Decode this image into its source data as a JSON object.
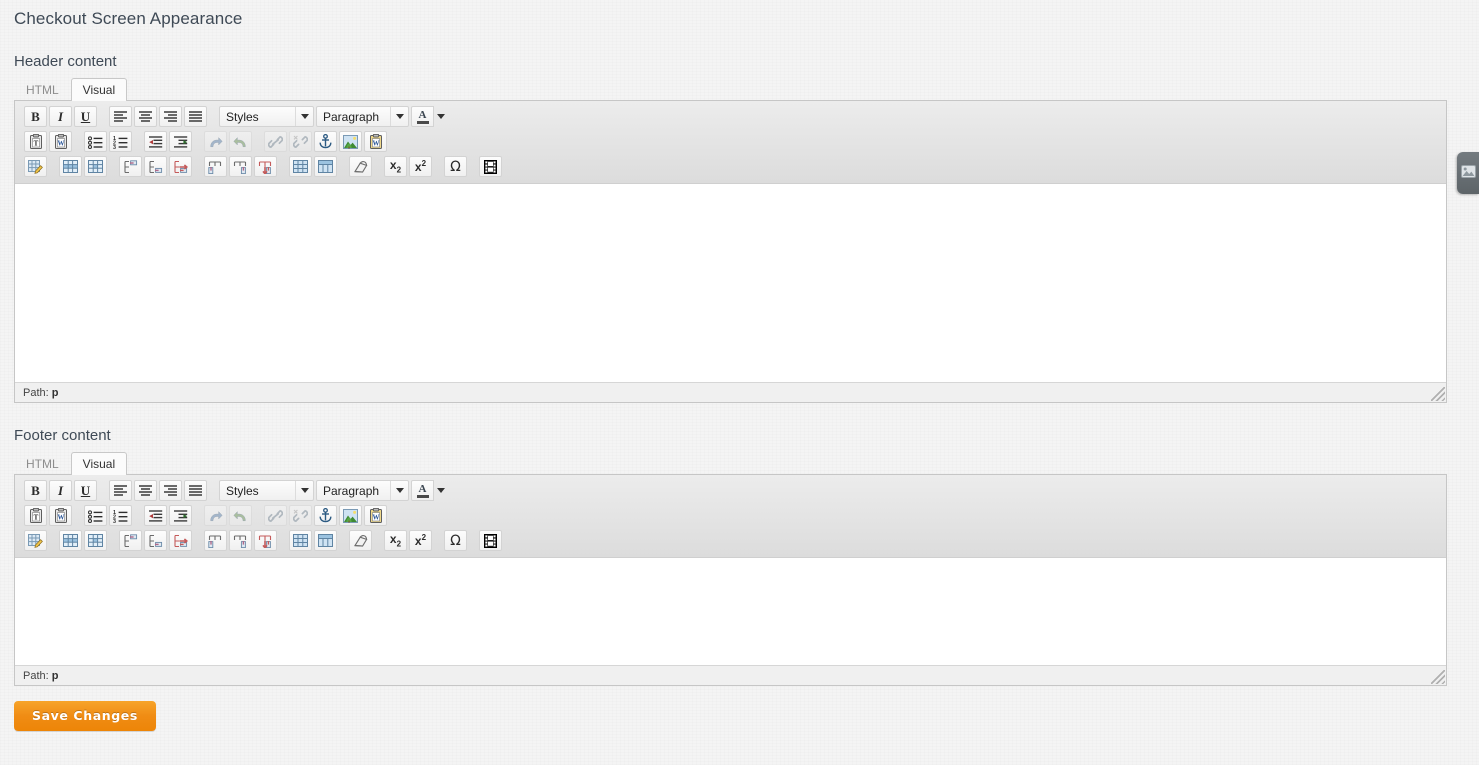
{
  "page": {
    "title": "Checkout Screen Appearance"
  },
  "colors": {
    "accent": "#f08c14",
    "page_bg": "#f4f4f4",
    "toolbar_bg": "#e4e4e4",
    "text": "#3f4a56"
  },
  "fields": [
    {
      "label": "Header content",
      "tabs": [
        {
          "label": "HTML",
          "active": false
        },
        {
          "label": "Visual",
          "active": true
        }
      ],
      "status": {
        "label": "Path:",
        "value": "p"
      },
      "body_height": 198,
      "content": ""
    },
    {
      "label": "Footer content",
      "tabs": [
        {
          "label": "HTML",
          "active": false
        },
        {
          "label": "Visual",
          "active": true
        }
      ],
      "status": {
        "label": "Path:",
        "value": "p"
      },
      "body_height": 107,
      "content": ""
    }
  ],
  "toolbar": {
    "rows": [
      [
        {
          "type": "button",
          "name": "bold-icon",
          "glyph": "B",
          "title": "Bold",
          "disabled": false
        },
        {
          "type": "button",
          "name": "italic-icon",
          "glyph": "I",
          "title": "Italic",
          "disabled": false
        },
        {
          "type": "button",
          "name": "underline-icon",
          "glyph": "U",
          "title": "Underline",
          "disabled": false
        },
        {
          "type": "sep"
        },
        {
          "type": "button",
          "name": "align-left-icon",
          "title": "Align left",
          "disabled": false
        },
        {
          "type": "button",
          "name": "align-center-icon",
          "title": "Align center",
          "disabled": false
        },
        {
          "type": "button",
          "name": "align-right-icon",
          "title": "Align right",
          "disabled": false
        },
        {
          "type": "button",
          "name": "align-justify-icon",
          "title": "Align full",
          "disabled": false
        },
        {
          "type": "sep"
        },
        {
          "type": "select",
          "name": "styles-select",
          "label": "Styles"
        },
        {
          "type": "select",
          "name": "paragraph-select",
          "label": "Paragraph"
        },
        {
          "type": "colorpicker",
          "name": "forecolor-picker",
          "title": "Text color"
        }
      ],
      [
        {
          "type": "button",
          "name": "paste-text-icon",
          "title": "Paste as plain text",
          "disabled": false
        },
        {
          "type": "button",
          "name": "paste-word-icon",
          "title": "Paste from Word",
          "disabled": false
        },
        {
          "type": "sep"
        },
        {
          "type": "button",
          "name": "bullet-list-icon",
          "title": "Unordered list",
          "disabled": false
        },
        {
          "type": "button",
          "name": "numbered-list-icon",
          "title": "Ordered list",
          "disabled": false
        },
        {
          "type": "sep"
        },
        {
          "type": "button",
          "name": "outdent-icon",
          "title": "Outdent",
          "disabled": false
        },
        {
          "type": "button",
          "name": "indent-icon",
          "title": "Indent",
          "disabled": false
        },
        {
          "type": "sep"
        },
        {
          "type": "button",
          "name": "undo-icon",
          "title": "Undo",
          "disabled": true
        },
        {
          "type": "button",
          "name": "redo-icon",
          "title": "Redo",
          "disabled": true
        },
        {
          "type": "sep"
        },
        {
          "type": "button",
          "name": "link-icon",
          "title": "Insert link",
          "disabled": true
        },
        {
          "type": "button",
          "name": "unlink-icon",
          "title": "Remove link",
          "disabled": true
        },
        {
          "type": "button",
          "name": "anchor-icon",
          "title": "Insert anchor",
          "disabled": false
        },
        {
          "type": "button",
          "name": "insert-image-icon",
          "title": "Insert image",
          "disabled": false
        },
        {
          "type": "button",
          "name": "paste-template-icon",
          "title": "Insert template",
          "disabled": false
        }
      ],
      [
        {
          "type": "button",
          "name": "table-properties-icon",
          "title": "Table properties",
          "disabled": false
        },
        {
          "type": "sep"
        },
        {
          "type": "button",
          "name": "row-properties-icon",
          "title": "Row properties",
          "disabled": false
        },
        {
          "type": "button",
          "name": "cell-properties-icon",
          "title": "Cell properties",
          "disabled": false
        },
        {
          "type": "sep"
        },
        {
          "type": "button",
          "name": "insert-row-before-icon",
          "title": "Insert row before",
          "disabled": false
        },
        {
          "type": "button",
          "name": "insert-row-after-icon",
          "title": "Insert row after",
          "disabled": false
        },
        {
          "type": "button",
          "name": "delete-row-icon",
          "title": "Delete row",
          "disabled": false
        },
        {
          "type": "sep"
        },
        {
          "type": "button",
          "name": "insert-column-before-icon",
          "title": "Insert column before",
          "disabled": false
        },
        {
          "type": "button",
          "name": "insert-column-after-icon",
          "title": "Insert column after",
          "disabled": false
        },
        {
          "type": "button",
          "name": "delete-column-icon",
          "title": "Delete column",
          "disabled": false
        },
        {
          "type": "sep"
        },
        {
          "type": "button",
          "name": "split-cells-icon",
          "title": "Split merged cells",
          "disabled": false
        },
        {
          "type": "button",
          "name": "merge-cells-icon",
          "title": "Merge cells",
          "disabled": false
        },
        {
          "type": "sep"
        },
        {
          "type": "button",
          "name": "remove-format-icon",
          "title": "Remove formatting",
          "disabled": false
        },
        {
          "type": "sep"
        },
        {
          "type": "button",
          "name": "subscript-icon",
          "title": "Subscript",
          "disabled": false
        },
        {
          "type": "button",
          "name": "superscript-icon",
          "title": "Superscript",
          "disabled": false
        },
        {
          "type": "sep"
        },
        {
          "type": "button",
          "name": "special-char-icon",
          "title": "Insert special character",
          "disabled": false
        },
        {
          "type": "sep"
        },
        {
          "type": "button",
          "name": "insert-media-icon",
          "title": "Insert media",
          "disabled": false
        }
      ]
    ]
  },
  "actions": {
    "save_label": "Save Changes"
  },
  "edge_tab": {
    "name": "screenshot-widget-tab"
  }
}
